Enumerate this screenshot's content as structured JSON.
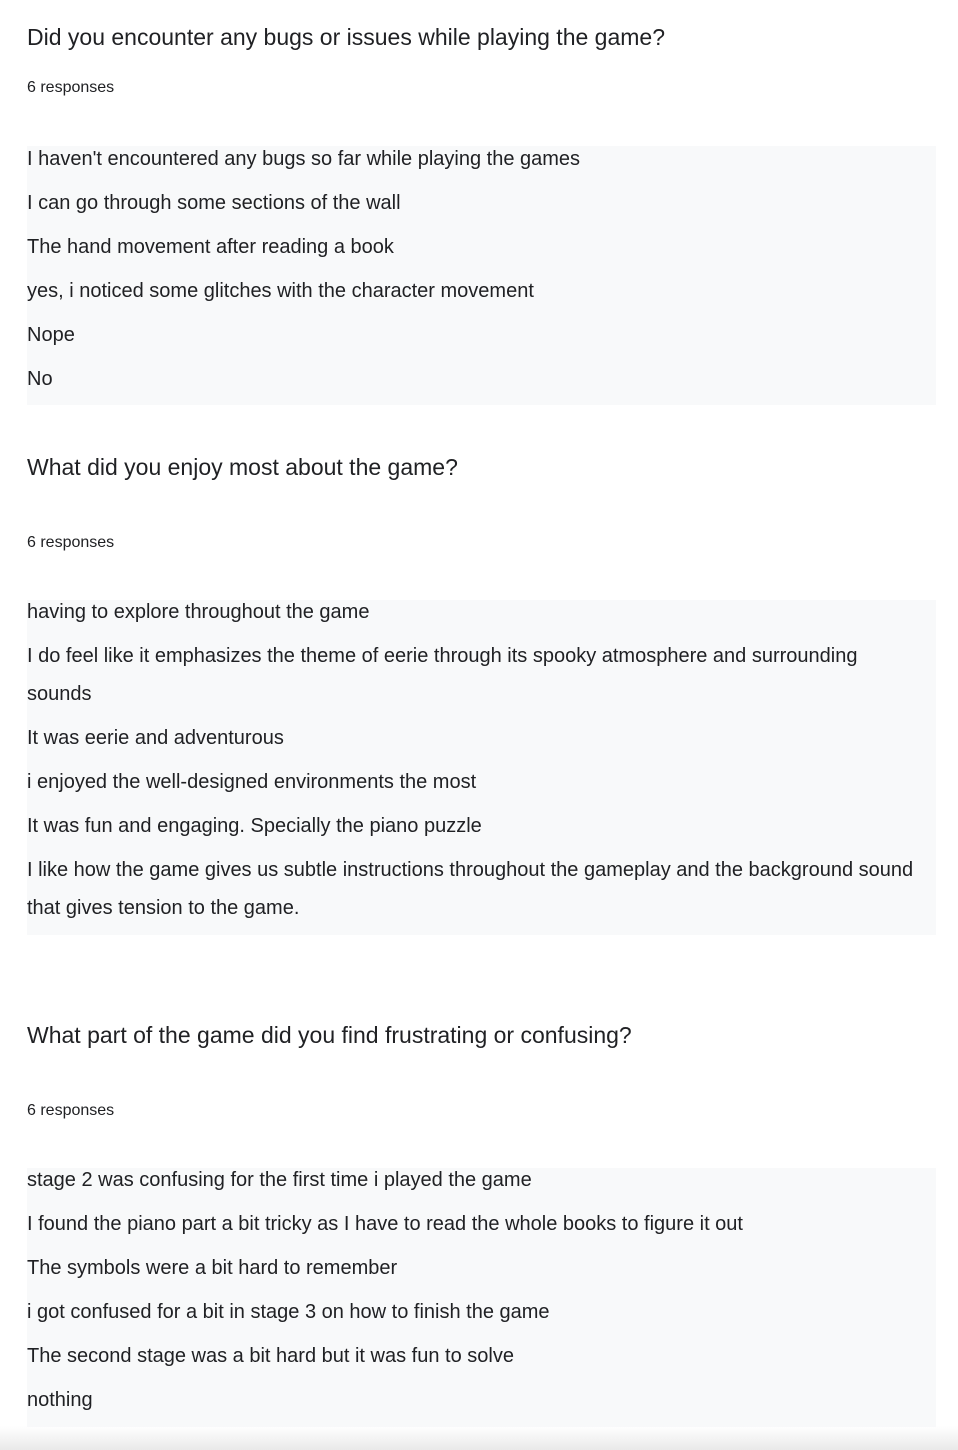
{
  "questions": [
    {
      "title": "Did you encounter any bugs or issues while playing the game?",
      "response_count": "6 responses",
      "responses": [
        "I haven't encountered any bugs so far while playing the games",
        "I can go through some sections of the wall",
        "The hand movement after reading a book",
        "yes, i noticed some glitches with the character movement",
        "Nope",
        "No"
      ]
    },
    {
      "title": "What did you enjoy most about the game?",
      "response_count": "6 responses",
      "responses": [
        "having to explore throughout the game",
        "I do feel like it emphasizes the theme of eerie through its spooky atmosphere and surrounding sounds",
        "It was eerie and adventurous",
        "i enjoyed the well-designed environments the most",
        "It was fun and engaging. Specially the piano puzzle",
        "I like how the game gives us subtle instructions throughout the gameplay and the background sound that gives tension to the game."
      ]
    },
    {
      "title": "What part of the game did you find frustrating or confusing?",
      "response_count": "6 responses",
      "responses": [
        "stage 2 was confusing for the first time i played the game",
        "I found the piano part a bit tricky as I have to read the whole books to figure it out",
        "The symbols were a bit hard to remember",
        "i got confused for a bit in stage 3 on how to finish the game",
        "The second stage was a bit hard but it was fun to solve",
        "nothing"
      ]
    }
  ]
}
